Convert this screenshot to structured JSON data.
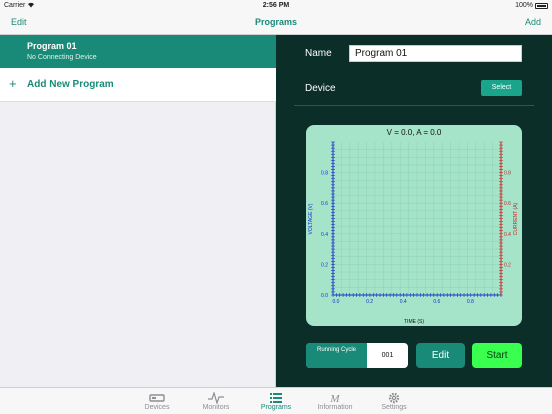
{
  "status_bar": {
    "carrier": "Carrier",
    "time": "2:56 PM",
    "battery": "100%"
  },
  "nav": {
    "left": "Edit",
    "title": "Programs",
    "right": "Add"
  },
  "sidebar": {
    "program": {
      "name": "Program 01",
      "subtitle": "No Connecting Device"
    },
    "add_label": "Add New Program",
    "add_icon": "+"
  },
  "detail": {
    "name_label": "Name",
    "name_value": "Program 01",
    "device_label": "Device",
    "select_label": "Select",
    "running_cycle_label": "Running Cycle",
    "running_cycle_value": "001",
    "edit_label": "Edit",
    "start_label": "Start"
  },
  "colors": {
    "accent": "#1a8a78",
    "detail_bg": "#0b2e29",
    "chart_bg": "#a5e4c9",
    "start": "#39ff4f",
    "voltage_axis": "#1a32c8",
    "current_axis": "#c62828"
  },
  "chart_data": {
    "type": "line",
    "title": "V = 0.0, A = 0.0",
    "xlabel": "TIME (S)",
    "ylabel": "VOLTAGE (V)",
    "y2label": "CURRENT (A)",
    "xlim": [
      0,
      1
    ],
    "ylim": [
      0,
      1
    ],
    "y2lim": [
      0,
      1
    ],
    "x_ticks": [
      "0.0",
      "0.2",
      "0.4",
      "0.6",
      "0.8"
    ],
    "y_ticks": [
      "0.0",
      "0.2",
      "0.4",
      "0.6",
      "0.8"
    ],
    "y2_ticks": [
      "0.2",
      "0.4",
      "0.6",
      "0.8"
    ],
    "grid": true,
    "series": []
  },
  "tabs": [
    {
      "label": "Devices",
      "icon": "devices-icon",
      "active": false
    },
    {
      "label": "Monitors",
      "icon": "monitors-icon",
      "active": false
    },
    {
      "label": "Programs",
      "icon": "programs-icon",
      "active": true
    },
    {
      "label": "Information",
      "icon": "information-icon",
      "active": false
    },
    {
      "label": "Settings",
      "icon": "gear-icon",
      "active": false
    }
  ]
}
